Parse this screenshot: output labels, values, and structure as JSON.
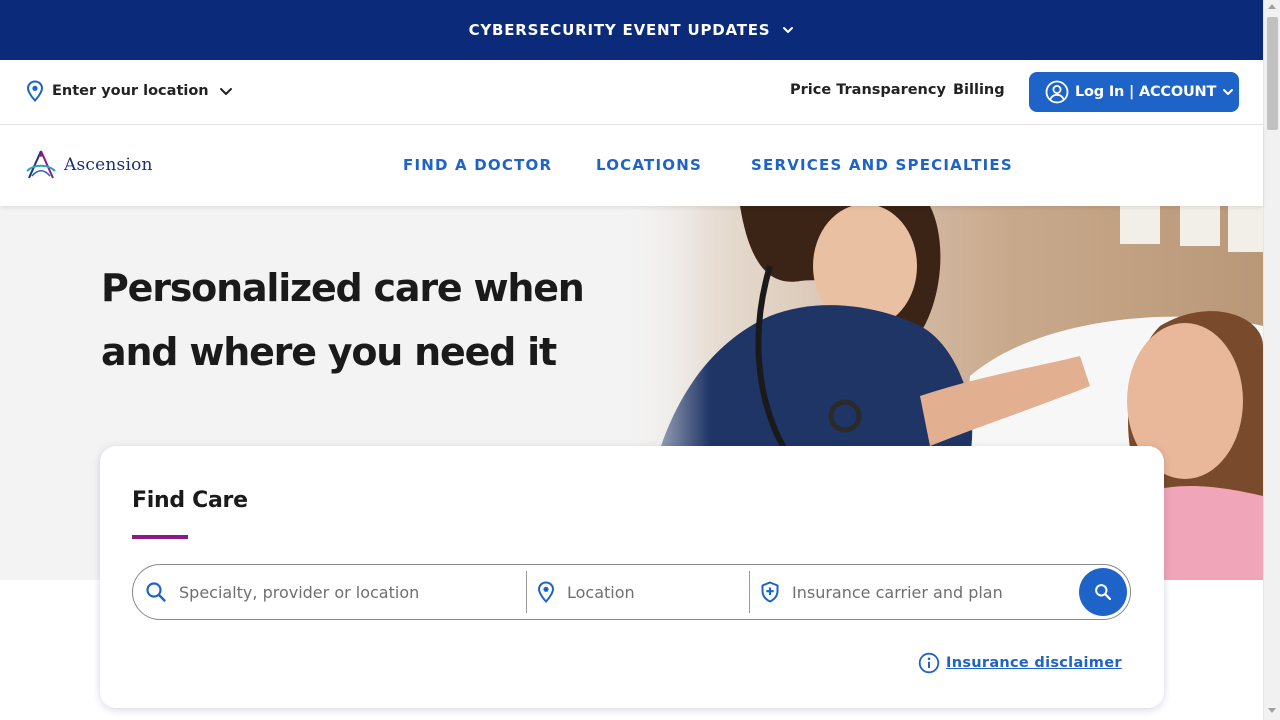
{
  "banner": {
    "label": "CYBERSECURITY EVENT UPDATES",
    "icon": "chevron-down-icon"
  },
  "utility_bar": {
    "location_label": "Enter your location",
    "location_icon": "map-pin-icon",
    "links": [
      {
        "label": "Price Transparency"
      },
      {
        "label": "Billing"
      }
    ],
    "login_label": "Log In | ACCOUNT",
    "login_icon": "user-circle-icon"
  },
  "main_nav": {
    "logo_text": "Ascension",
    "items": [
      {
        "label": "FIND A DOCTOR"
      },
      {
        "label": "LOCATIONS"
      },
      {
        "label": "SERVICES AND SPECIALTIES"
      }
    ]
  },
  "hero": {
    "title": "Personalized care when and where you need it",
    "image": "nurse-with-child-patient-photo"
  },
  "find_care": {
    "title": "Find Care",
    "specialty_placeholder": "Specialty, provider or location",
    "location_placeholder": "Location",
    "insurance_placeholder": "Insurance carrier and plan",
    "search_icon": "search-icon",
    "disclaimer_label": "Insurance disclaimer",
    "disclaimer_icon": "info-icon"
  },
  "colors": {
    "banner_bg": "#0b2a7a",
    "primary_blue": "#1e63c8",
    "accent_purple": "#8b1a89",
    "hero_bg": "#f3f3f3"
  }
}
